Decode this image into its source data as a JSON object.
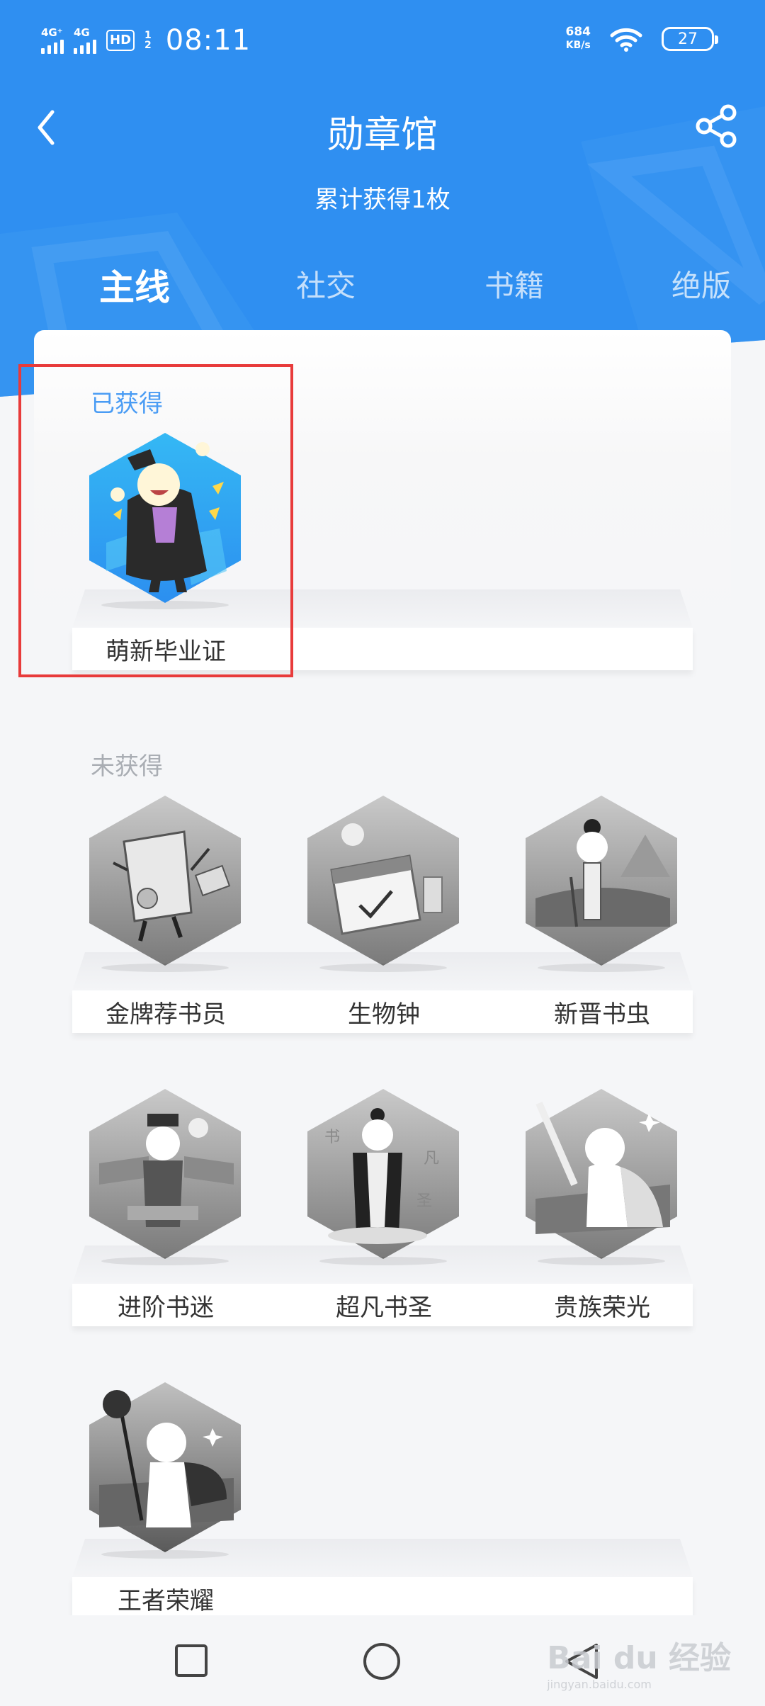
{
  "status_bar": {
    "signal1": "4G⁺",
    "signal2": "4G",
    "hd_label": "HD",
    "hd_sub1": "1",
    "hd_sub2": "2",
    "time": "08:11",
    "speed_value": "684",
    "speed_unit": "KB/s",
    "battery": "27"
  },
  "header": {
    "title": "勋章馆",
    "subtitle": "累计获得1枚",
    "back_icon": "chevron-left-icon",
    "share_icon": "share-icon"
  },
  "tabs": [
    {
      "label": "主线",
      "active": true
    },
    {
      "label": "社交",
      "active": false
    },
    {
      "label": "书籍",
      "active": false
    },
    {
      "label": "绝版",
      "active": false
    }
  ],
  "earned": {
    "label": "已获得",
    "badges": [
      {
        "name": "萌新毕业证"
      }
    ]
  },
  "unearned": {
    "label": "未获得",
    "badges": [
      {
        "name": "金牌荐书员"
      },
      {
        "name": "生物钟"
      },
      {
        "name": "新晋书虫"
      },
      {
        "name": "进阶书迷"
      },
      {
        "name": "超凡书圣"
      },
      {
        "name": "贵族荣光"
      },
      {
        "name": "王者荣耀"
      }
    ]
  },
  "watermark": {
    "brand": "Bai du 经验",
    "url": "jingyan.baidu.com"
  },
  "colors": {
    "primary": "#2f8ff1",
    "earned_label": "#4a9cf4",
    "highlight": "#e83b3b"
  }
}
